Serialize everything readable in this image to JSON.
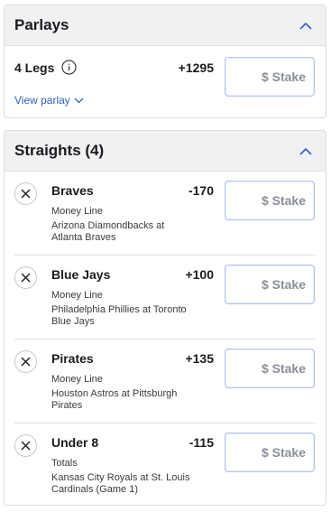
{
  "parlays": {
    "title": "Parlays",
    "legs_label": "4 Legs",
    "odds": "+1295",
    "stake_placeholder": "$ Stake",
    "view_link": "View parlay"
  },
  "straights": {
    "title": "Straights (4)",
    "stake_placeholder": "$ Stake",
    "bets": [
      {
        "name": "Braves",
        "type": "Money Line",
        "game": "Arizona Diamondbacks at Atlanta Braves",
        "odds": "-170"
      },
      {
        "name": "Blue Jays",
        "type": "Money Line",
        "game": "Philadelphia Phillies at Toronto Blue Jays",
        "odds": "+100"
      },
      {
        "name": "Pirates",
        "type": "Money Line",
        "game": "Houston Astros at Pittsburgh Pirates",
        "odds": "+135"
      },
      {
        "name": "Under 8",
        "type": "Totals",
        "game": "Kansas City Royals at St. Louis Cardinals (Game 1)",
        "odds": "-115"
      }
    ]
  },
  "icons": {
    "collapse": "chevron-up-icon",
    "info": "info-icon",
    "expand": "chevron-down-icon",
    "remove": "close-icon"
  },
  "colors": {
    "header_bg": "#f1f1f3",
    "link": "#2f5fc6",
    "stake_border": "#b7c4e8",
    "stake_text": "#8a8f9a"
  }
}
